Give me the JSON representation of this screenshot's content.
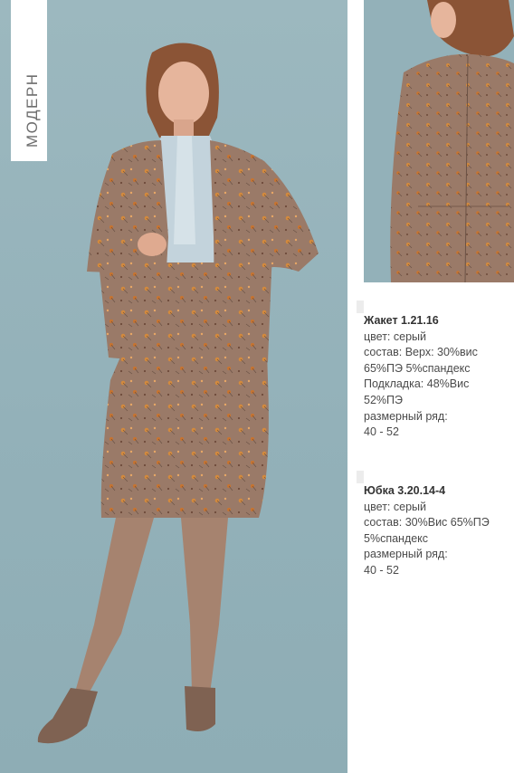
{
  "collection": {
    "label": "МОДЕРН"
  },
  "images": {
    "main": "model-front-photo",
    "back": "model-back-photo"
  },
  "products": [
    {
      "title": "Жакет 1.21.16",
      "lines": [
        "цвет: серый",
        "состав: Верх: 30%вис",
        "65%ПЭ 5%спандекс",
        "Подкладка: 48%Вис",
        "52%ПЭ",
        "размерный ряд:",
        "40 - 52"
      ]
    },
    {
      "title": "Юбка 3.20.14-4",
      "lines": [
        "цвет: серый",
        "состав: 30%Вис 65%ПЭ",
        "5%спандекс",
        "размерный ряд:",
        "40 - 52"
      ]
    }
  ],
  "colors": {
    "backdrop": "#93b1b9",
    "fabric": "#9a7a68",
    "blouse": "#c3d3dc",
    "text": "#4a4a4a"
  }
}
